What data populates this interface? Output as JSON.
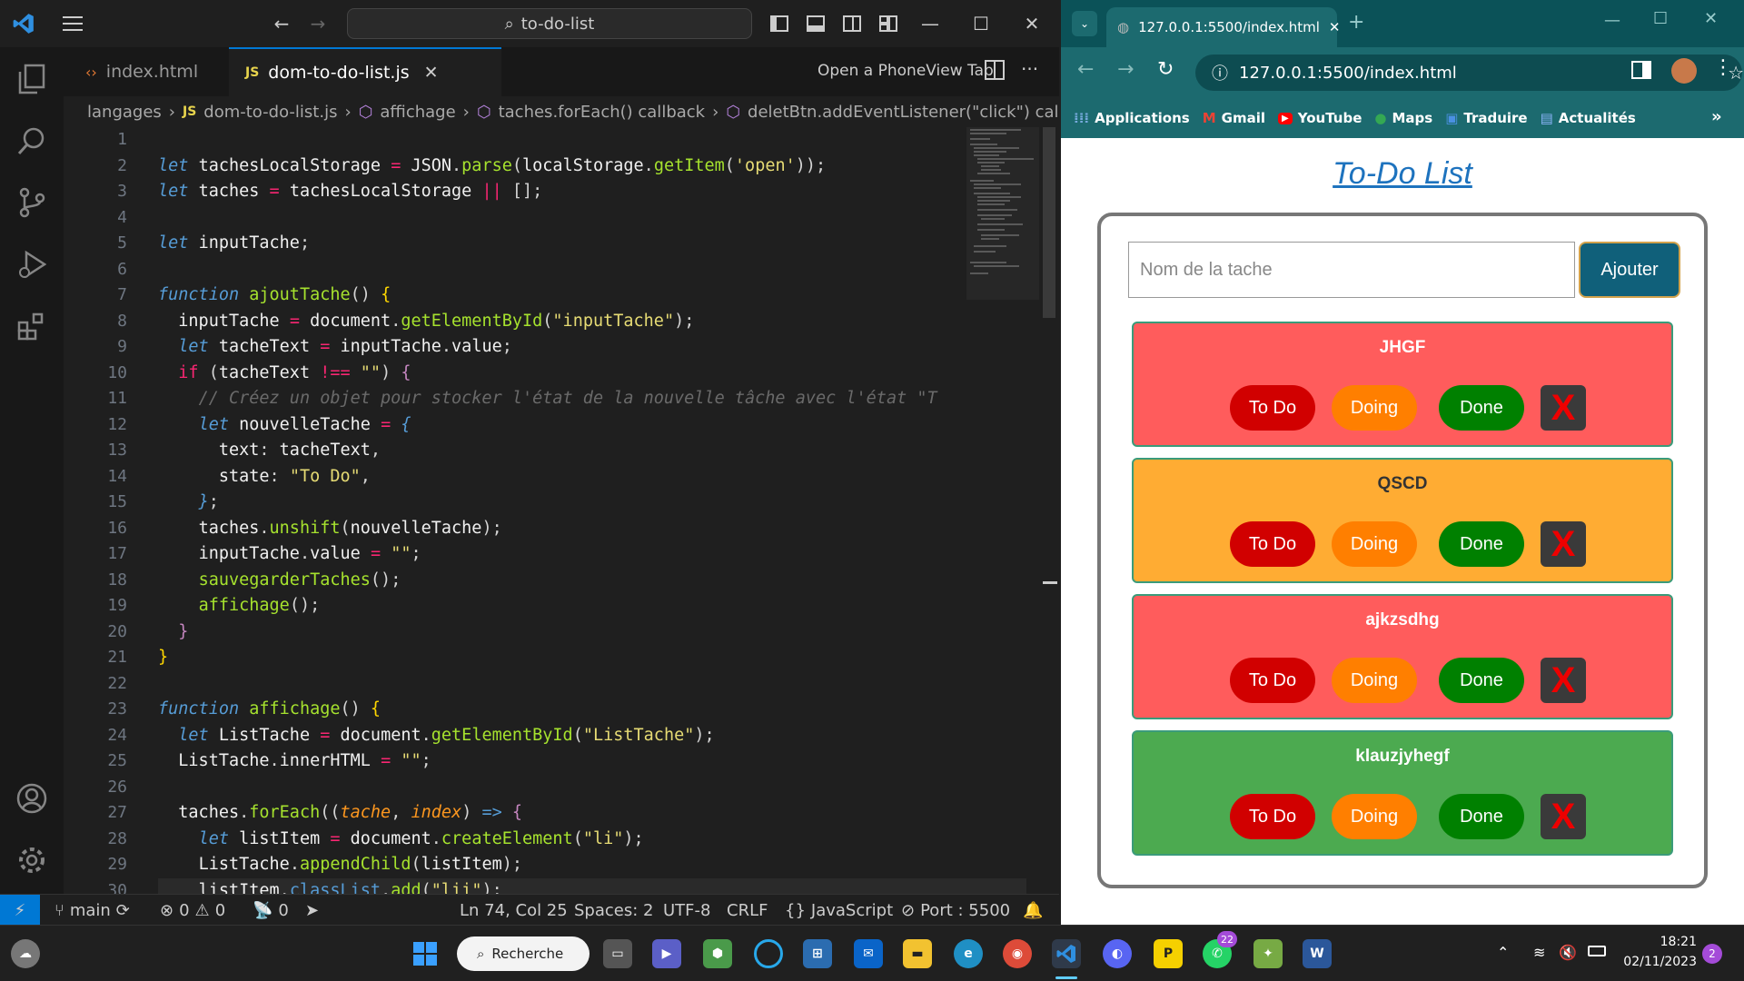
{
  "vscode": {
    "command_center": "to-do-list",
    "tabs": [
      {
        "label": "index.html",
        "icon": "html-file-icon"
      },
      {
        "label": "dom-to-do-list.js",
        "icon": "js-file-icon"
      }
    ],
    "phoneview_label": "Open a PhoneView Tab",
    "breadcrumb": [
      "langages",
      "dom-to-do-list.js",
      "affichage",
      "taches.forEach() callback",
      "deletBtn.addEventListener(\"click\") callback"
    ],
    "line_numbers": [
      "1",
      "2",
      "3",
      "4",
      "5",
      "6",
      "7",
      "8",
      "9",
      "10",
      "11",
      "12",
      "13",
      "14",
      "15",
      "16",
      "17",
      "18",
      "19",
      "20",
      "21",
      "22",
      "23",
      "24",
      "25",
      "26",
      "27",
      "28",
      "29",
      "30"
    ],
    "statusbar": {
      "branch": "main",
      "errors": "0",
      "warnings": "0",
      "ports": "0",
      "cursor": "Ln 74, Col 25",
      "spaces": "Spaces: 2",
      "encoding": "UTF-8",
      "eol": "CRLF",
      "language": "JavaScript",
      "port": "Port : 5500"
    },
    "accent": "#0078d4"
  },
  "browser": {
    "tab_title": "127.0.0.1:5500/index.html",
    "url": "127.0.0.1:5500/index.html",
    "bookmarks": [
      "Applications",
      "Gmail",
      "YouTube",
      "Maps",
      "Traduire",
      "Actualités"
    ],
    "theme_color": "#1c6a6f",
    "page": {
      "title": "To-Do List",
      "input_placeholder": "Nom de la tache",
      "add_label": "Ajouter",
      "tasks": [
        {
          "name": "JHGF",
          "color": "#ff5c5c"
        },
        {
          "name": "QSCD",
          "color": "#ffac33"
        },
        {
          "name": "ajkzsdhg",
          "color": "#ff5c5c"
        },
        {
          "name": "klauzjyhegf",
          "color": "#4caa50"
        }
      ],
      "btn_todo": "To Do",
      "btn_doing": "Doing",
      "btn_done": "Done",
      "btn_delete": "X"
    }
  },
  "taskbar": {
    "search_label": "Recherche",
    "time": "18:21",
    "date": "02/11/2023",
    "whatsapp_badge": "22",
    "notification_count": "2"
  }
}
